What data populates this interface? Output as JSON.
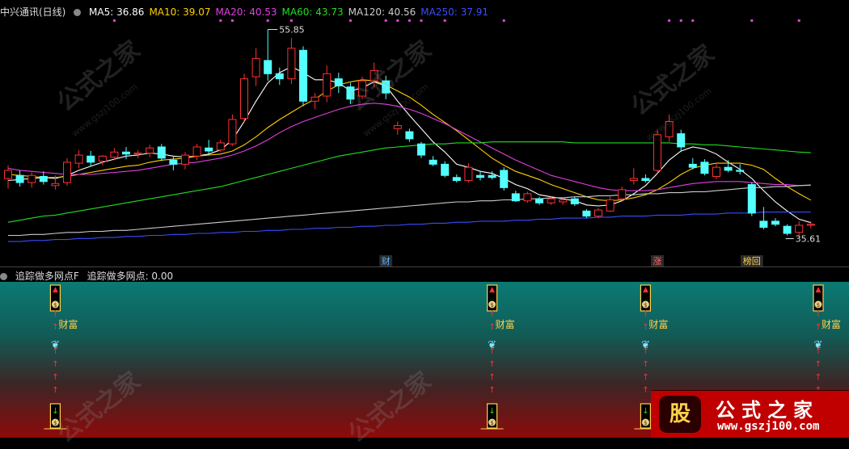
{
  "header": {
    "stock_name": "中兴通讯(日线)",
    "ma_labels": [
      {
        "key": "MA5",
        "value": "36.86",
        "color": "#ffffff"
      },
      {
        "key": "MA10",
        "value": "39.07",
        "color": "#ffd000"
      },
      {
        "key": "MA20",
        "value": "40.53",
        "color": "#e040e0"
      },
      {
        "key": "MA60",
        "value": "43.73",
        "color": "#22dd22"
      },
      {
        "key": "MA120",
        "value": "40.56",
        "color": "#cccccc"
      },
      {
        "key": "MA250",
        "value": "37.91",
        "color": "#3a4cff"
      }
    ]
  },
  "indicator": {
    "name": "追踪做多网点F",
    "value_label": "追踪做多网点: 0.00",
    "signal_text": "财富"
  },
  "colors": {
    "up": "#ff3030",
    "down": "#54ffff",
    "ma5": "#ffffff",
    "ma10": "#ffd000",
    "ma20": "#e040e0",
    "ma60": "#22dd22",
    "ma120": "#cccccc",
    "ma250": "#3a4cff",
    "accent": "#ffd24a"
  },
  "chart_data": {
    "type": "candlestick",
    "title": "中兴通讯(日线)",
    "ylim": [
      33.5,
      57.0
    ],
    "annotations": {
      "high_label": "55.85",
      "low_label": "35.61"
    },
    "event_markers": [
      {
        "index": 32,
        "text": "财",
        "color": "#5ab0ff"
      },
      {
        "index": 55,
        "text": "涨",
        "color": "#ff6666"
      },
      {
        "index": 63,
        "text": "榜回",
        "color": "#ffd24a"
      }
    ],
    "candles": [
      {
        "o": 41.2,
        "h": 42.5,
        "l": 40.2,
        "c": 42.0
      },
      {
        "o": 41.5,
        "h": 42.0,
        "l": 40.4,
        "c": 40.8
      },
      {
        "o": 40.8,
        "h": 41.8,
        "l": 40.3,
        "c": 41.5
      },
      {
        "o": 41.4,
        "h": 41.9,
        "l": 40.6,
        "c": 40.9
      },
      {
        "o": 40.5,
        "h": 41.5,
        "l": 40.1,
        "c": 40.7
      },
      {
        "o": 40.8,
        "h": 43.2,
        "l": 40.5,
        "c": 42.8
      },
      {
        "o": 42.7,
        "h": 44.0,
        "l": 42.2,
        "c": 43.5
      },
      {
        "o": 43.4,
        "h": 43.9,
        "l": 42.4,
        "c": 42.8
      },
      {
        "o": 42.9,
        "h": 43.5,
        "l": 42.5,
        "c": 43.4
      },
      {
        "o": 43.3,
        "h": 44.2,
        "l": 43.0,
        "c": 43.8
      },
      {
        "o": 43.8,
        "h": 44.3,
        "l": 43.1,
        "c": 43.6
      },
      {
        "o": 43.6,
        "h": 44.0,
        "l": 43.2,
        "c": 43.7
      },
      {
        "o": 43.7,
        "h": 44.5,
        "l": 43.3,
        "c": 44.2
      },
      {
        "o": 44.3,
        "h": 44.6,
        "l": 42.9,
        "c": 43.2
      },
      {
        "o": 43.0,
        "h": 43.4,
        "l": 42.0,
        "c": 42.6
      },
      {
        "o": 42.6,
        "h": 43.8,
        "l": 42.1,
        "c": 43.5
      },
      {
        "o": 43.4,
        "h": 44.6,
        "l": 43.0,
        "c": 44.3
      },
      {
        "o": 44.2,
        "h": 45.0,
        "l": 43.6,
        "c": 43.9
      },
      {
        "o": 44.0,
        "h": 45.0,
        "l": 43.8,
        "c": 44.7
      },
      {
        "o": 44.6,
        "h": 47.5,
        "l": 44.4,
        "c": 47.0
      },
      {
        "o": 47.1,
        "h": 51.5,
        "l": 46.8,
        "c": 51.0
      },
      {
        "o": 51.2,
        "h": 54.0,
        "l": 50.3,
        "c": 53.0
      },
      {
        "o": 52.8,
        "h": 55.85,
        "l": 50.8,
        "c": 51.5
      },
      {
        "o": 51.5,
        "h": 52.1,
        "l": 50.4,
        "c": 51.0
      },
      {
        "o": 51.0,
        "h": 55.0,
        "l": 50.5,
        "c": 54.0
      },
      {
        "o": 53.8,
        "h": 54.2,
        "l": 48.3,
        "c": 48.8
      },
      {
        "o": 48.8,
        "h": 49.6,
        "l": 48.0,
        "c": 49.2
      },
      {
        "o": 49.3,
        "h": 52.3,
        "l": 48.7,
        "c": 51.5
      },
      {
        "o": 51.0,
        "h": 51.6,
        "l": 49.6,
        "c": 50.3
      },
      {
        "o": 50.2,
        "h": 50.6,
        "l": 48.5,
        "c": 49.0
      },
      {
        "o": 49.3,
        "h": 51.2,
        "l": 49.0,
        "c": 50.8
      },
      {
        "o": 50.8,
        "h": 52.6,
        "l": 50.2,
        "c": 51.8
      },
      {
        "o": 50.8,
        "h": 51.3,
        "l": 49.0,
        "c": 49.6
      },
      {
        "o": 46.1,
        "h": 46.8,
        "l": 45.5,
        "c": 46.4
      },
      {
        "o": 45.8,
        "h": 46.1,
        "l": 44.8,
        "c": 45.1
      },
      {
        "o": 44.6,
        "h": 44.8,
        "l": 43.2,
        "c": 43.5
      },
      {
        "o": 43.0,
        "h": 43.4,
        "l": 42.4,
        "c": 42.6
      },
      {
        "o": 42.6,
        "h": 42.9,
        "l": 41.3,
        "c": 41.5
      },
      {
        "o": 41.3,
        "h": 41.6,
        "l": 40.8,
        "c": 41.0
      },
      {
        "o": 41.0,
        "h": 42.7,
        "l": 40.8,
        "c": 42.3
      },
      {
        "o": 41.5,
        "h": 41.9,
        "l": 41.0,
        "c": 41.3
      },
      {
        "o": 41.5,
        "h": 41.9,
        "l": 41.1,
        "c": 41.3
      },
      {
        "o": 42.0,
        "h": 42.3,
        "l": 40.0,
        "c": 40.3
      },
      {
        "o": 39.7,
        "h": 40.0,
        "l": 38.9,
        "c": 39.0
      },
      {
        "o": 39.0,
        "h": 39.9,
        "l": 38.8,
        "c": 39.7
      },
      {
        "o": 39.2,
        "h": 39.4,
        "l": 38.6,
        "c": 38.8
      },
      {
        "o": 38.8,
        "h": 39.5,
        "l": 38.6,
        "c": 39.2
      },
      {
        "o": 38.9,
        "h": 39.3,
        "l": 38.6,
        "c": 39.1
      },
      {
        "o": 39.2,
        "h": 39.4,
        "l": 38.5,
        "c": 38.7
      },
      {
        "o": 38.0,
        "h": 38.2,
        "l": 37.3,
        "c": 37.5
      },
      {
        "o": 37.5,
        "h": 38.3,
        "l": 37.3,
        "c": 38.1
      },
      {
        "o": 38.0,
        "h": 39.4,
        "l": 37.9,
        "c": 39.1
      },
      {
        "o": 39.2,
        "h": 40.4,
        "l": 39.0,
        "c": 40.1
      },
      {
        "o": 41.0,
        "h": 42.2,
        "l": 40.6,
        "c": 41.2
      },
      {
        "o": 41.2,
        "h": 41.6,
        "l": 40.8,
        "c": 41.0
      },
      {
        "o": 42.0,
        "h": 46.0,
        "l": 41.7,
        "c": 45.5
      },
      {
        "o": 45.3,
        "h": 47.5,
        "l": 44.8,
        "c": 46.8
      },
      {
        "o": 45.6,
        "h": 46.0,
        "l": 43.8,
        "c": 44.3
      },
      {
        "o": 42.6,
        "h": 43.2,
        "l": 42.1,
        "c": 42.3
      },
      {
        "o": 42.8,
        "h": 43.1,
        "l": 41.5,
        "c": 41.7
      },
      {
        "o": 41.4,
        "h": 42.6,
        "l": 41.1,
        "c": 42.3
      },
      {
        "o": 42.3,
        "h": 43.0,
        "l": 41.8,
        "c": 42.0
      },
      {
        "o": 42.0,
        "h": 42.6,
        "l": 41.6,
        "c": 41.9
      },
      {
        "o": 40.6,
        "h": 40.8,
        "l": 37.5,
        "c": 37.8
      },
      {
        "o": 37.0,
        "h": 38.4,
        "l": 36.2,
        "c": 36.4
      },
      {
        "o": 37.0,
        "h": 37.3,
        "l": 36.5,
        "c": 36.7
      },
      {
        "o": 36.5,
        "h": 36.7,
        "l": 35.6,
        "c": 35.8
      },
      {
        "o": 35.9,
        "h": 37.0,
        "l": 35.61,
        "c": 36.6
      },
      {
        "o": 36.6,
        "h": 37.0,
        "l": 36.3,
        "c": 36.7
      }
    ],
    "ma_lines": {
      "MA5": [
        41.0,
        41.1,
        41.2,
        41.3,
        41.2,
        41.5,
        42.0,
        42.4,
        42.8,
        43.1,
        43.4,
        43.5,
        43.7,
        43.6,
        43.4,
        43.3,
        43.4,
        43.6,
        44.0,
        45.0,
        46.8,
        48.8,
        50.6,
        51.6,
        52.2,
        51.6,
        50.9,
        50.9,
        50.6,
        49.8,
        50.1,
        50.7,
        50.3,
        48.8,
        47.4,
        46.1,
        44.8,
        43.8,
        42.6,
        42.3,
        41.9,
        41.7,
        41.2,
        40.6,
        40.2,
        39.6,
        39.4,
        39.2,
        39.0,
        38.6,
        38.5,
        38.6,
        39.0,
        39.7,
        40.5,
        41.7,
        43.0,
        43.9,
        44.3,
        44.1,
        43.6,
        42.8,
        42.1,
        41.2,
        40.0,
        38.9,
        38.0,
        37.2,
        36.86
      ],
      "MA10": [
        41.6,
        41.5,
        41.4,
        41.3,
        41.3,
        41.4,
        41.6,
        41.8,
        42.0,
        42.2,
        42.4,
        42.5,
        42.8,
        43.0,
        43.1,
        43.2,
        43.4,
        43.5,
        43.6,
        43.9,
        44.5,
        45.3,
        46.2,
        47.0,
        47.7,
        48.4,
        49.0,
        49.8,
        50.4,
        50.7,
        50.9,
        50.8,
        50.4,
        49.8,
        49.2,
        48.4,
        47.5,
        46.7,
        45.9,
        45.0,
        44.1,
        43.2,
        42.5,
        41.9,
        41.5,
        41.1,
        40.6,
        40.2,
        39.8,
        39.4,
        39.1,
        39.0,
        39.1,
        39.3,
        39.6,
        40.1,
        40.8,
        41.6,
        42.2,
        42.5,
        42.7,
        42.7,
        42.7,
        42.5,
        42.1,
        41.2,
        40.4,
        39.7,
        39.07
      ],
      "MA20": [
        42.2,
        42.0,
        41.9,
        41.8,
        41.7,
        41.6,
        41.6,
        41.6,
        41.7,
        41.8,
        41.9,
        42.0,
        42.2,
        42.4,
        42.6,
        42.7,
        42.8,
        43.0,
        43.2,
        43.5,
        43.9,
        44.4,
        45.0,
        45.7,
        46.3,
        46.8,
        47.2,
        47.6,
        48.0,
        48.3,
        48.5,
        48.6,
        48.5,
        48.3,
        48.0,
        47.6,
        47.1,
        46.6,
        46.0,
        45.4,
        44.8,
        44.2,
        43.6,
        43.0,
        42.5,
        42.0,
        41.5,
        41.2,
        40.9,
        40.6,
        40.3,
        40.1,
        40.0,
        40.0,
        40.0,
        40.1,
        40.3,
        40.5,
        40.7,
        40.8,
        40.9,
        40.9,
        40.9,
        40.8,
        40.7,
        40.6,
        40.6,
        40.5,
        40.53
      ],
      "MA60": [
        36.9,
        37.1,
        37.3,
        37.5,
        37.6,
        37.8,
        38.0,
        38.2,
        38.4,
        38.6,
        38.8,
        39.0,
        39.2,
        39.4,
        39.6,
        39.8,
        40.0,
        40.2,
        40.4,
        40.7,
        41.0,
        41.3,
        41.6,
        41.9,
        42.2,
        42.5,
        42.8,
        43.1,
        43.4,
        43.6,
        43.8,
        44.0,
        44.2,
        44.3,
        44.4,
        44.5,
        44.6,
        44.6,
        44.7,
        44.7,
        44.7,
        44.8,
        44.8,
        44.8,
        44.8,
        44.8,
        44.8,
        44.8,
        44.7,
        44.7,
        44.7,
        44.7,
        44.7,
        44.7,
        44.7,
        44.7,
        44.7,
        44.6,
        44.6,
        44.5,
        44.5,
        44.4,
        44.3,
        44.2,
        44.1,
        44.0,
        43.9,
        43.8,
        43.73
      ],
      "MA120": [
        35.6,
        35.6,
        35.7,
        35.7,
        35.8,
        35.9,
        35.9,
        36.0,
        36.0,
        36.1,
        36.1,
        36.2,
        36.3,
        36.4,
        36.5,
        36.6,
        36.7,
        36.8,
        36.9,
        37.0,
        37.1,
        37.2,
        37.3,
        37.4,
        37.5,
        37.6,
        37.7,
        37.8,
        37.9,
        38.0,
        38.1,
        38.2,
        38.3,
        38.4,
        38.5,
        38.6,
        38.7,
        38.8,
        38.9,
        38.9,
        39.0,
        39.0,
        39.1,
        39.1,
        39.2,
        39.2,
        39.3,
        39.3,
        39.4,
        39.4,
        39.5,
        39.5,
        39.6,
        39.6,
        39.7,
        39.7,
        39.8,
        39.8,
        39.9,
        39.9,
        40.0,
        40.1,
        40.2,
        40.3,
        40.3,
        40.4,
        40.4,
        40.5,
        40.56
      ],
      "MA250": [
        35.0,
        35.0,
        35.1,
        35.1,
        35.2,
        35.2,
        35.3,
        35.3,
        35.4,
        35.4,
        35.5,
        35.5,
        35.6,
        35.6,
        35.7,
        35.7,
        35.8,
        35.8,
        35.9,
        35.9,
        36.0,
        36.0,
        36.1,
        36.1,
        36.2,
        36.2,
        36.3,
        36.3,
        36.4,
        36.4,
        36.5,
        36.5,
        36.6,
        36.6,
        36.7,
        36.7,
        36.8,
        36.8,
        36.9,
        36.9,
        37.0,
        37.0,
        37.0,
        37.1,
        37.1,
        37.2,
        37.2,
        37.3,
        37.3,
        37.3,
        37.4,
        37.4,
        37.5,
        37.5,
        37.5,
        37.6,
        37.6,
        37.6,
        37.7,
        37.7,
        37.7,
        37.8,
        37.8,
        37.8,
        37.9,
        37.9,
        37.9,
        37.9,
        37.91
      ]
    },
    "top_dot_indices": [
      9,
      18,
      19,
      22,
      24,
      29,
      32,
      33,
      34,
      35,
      37,
      42,
      56,
      57,
      58,
      63,
      67
    ],
    "indicator_signals": [
      4,
      41,
      54,
      72
    ]
  }
}
